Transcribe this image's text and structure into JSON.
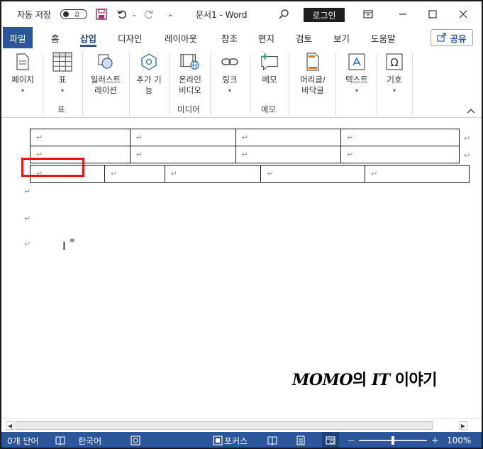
{
  "titlebar": {
    "autosave_label": "자동 저장",
    "autosave_state": "끔",
    "doc_title": "문서1  -  Word",
    "login_label": "로그인",
    "undo_dropdown": "⌄",
    "qat_dropdown": "⌄"
  },
  "tabs": {
    "file": "파일",
    "home": "홈",
    "insert": "삽입",
    "design": "디자인",
    "layout": "레이아웃",
    "references": "참조",
    "mailings": "편지",
    "review": "검토",
    "view": "보기",
    "help": "도움말",
    "share": "공유"
  },
  "ribbon": {
    "pages_label": "페이지",
    "table_label": "표",
    "table_group": "표",
    "illustrations_label_1": "일러스트",
    "illustrations_label_2": "레이션",
    "addins_label_1": "추가 기",
    "addins_label_2": "능",
    "online_video_label_1": "온라인",
    "online_video_label_2": "비디오",
    "media_group": "미디어",
    "link_label": "링크",
    "comment_label": "메모",
    "comments_group": "메모",
    "header_footer_label_1": "머리글/",
    "header_footer_label_2": "바닥글",
    "text_label": "텍스트",
    "symbols_label": "기호"
  },
  "document": {
    "para_mark": "↵",
    "watermark_bold": "MOMO",
    "watermark_mid": "의 ",
    "watermark_it": "IT",
    "watermark_tail": " 이야기"
  },
  "statusbar": {
    "word_count": "0개 단어",
    "language": "한국어",
    "focus": "포커스",
    "zoom": "100%",
    "zoom_level_percent": 100,
    "minus": "—",
    "plus": "+"
  }
}
